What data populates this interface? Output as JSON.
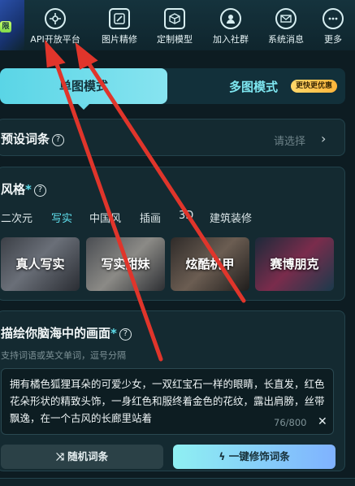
{
  "nav": {
    "badge": "限",
    "items": [
      {
        "label": "API开放平台",
        "icon": "api-icon"
      },
      {
        "label": "图片精修",
        "icon": "image-edit-icon"
      },
      {
        "label": "定制模型",
        "icon": "model-cube-icon"
      },
      {
        "label": "加入社群",
        "icon": "community-icon"
      },
      {
        "label": "系统消息",
        "icon": "mail-icon"
      },
      {
        "label": "更多",
        "icon": "more-icon"
      }
    ]
  },
  "mode_tabs": {
    "single": "单图模式",
    "multi": "多图模式",
    "multi_tag": "更快更优惠"
  },
  "preset": {
    "title": "预设词条",
    "help": "?",
    "placeholder": "请选择",
    "chevron": "›"
  },
  "style": {
    "title": "风格",
    "required_mark": "*",
    "help": "?",
    "tabs": [
      "二次元",
      "写实",
      "中国风",
      "插画",
      "3D",
      "建筑装修"
    ],
    "active_tab": "写实",
    "cards": [
      "真人写实",
      "写实甜妹",
      "炫酷机甲",
      "赛博朋克"
    ]
  },
  "prompt": {
    "title": "描绘你脑海中的画面",
    "required_mark": "*",
    "help": "?",
    "hint": "支持词语或英文单词，逗号分隔",
    "text": "拥有橘色狐狸耳朵的可爱少女，一双红宝石一样的眼睛，长直发，红色花朵形状的精致头饰，一身红色和服终着金色的花纹，露出肩膀，丝带飘逸，在一个古风的长廊里站着",
    "counter": "76/800",
    "clear": "✕",
    "random_button": "随机词条",
    "enhance_button": "一键修饰词条"
  },
  "colors": {
    "accent": "#5fe0ee",
    "arrow": "#e0352b",
    "panel": "#142a31"
  }
}
